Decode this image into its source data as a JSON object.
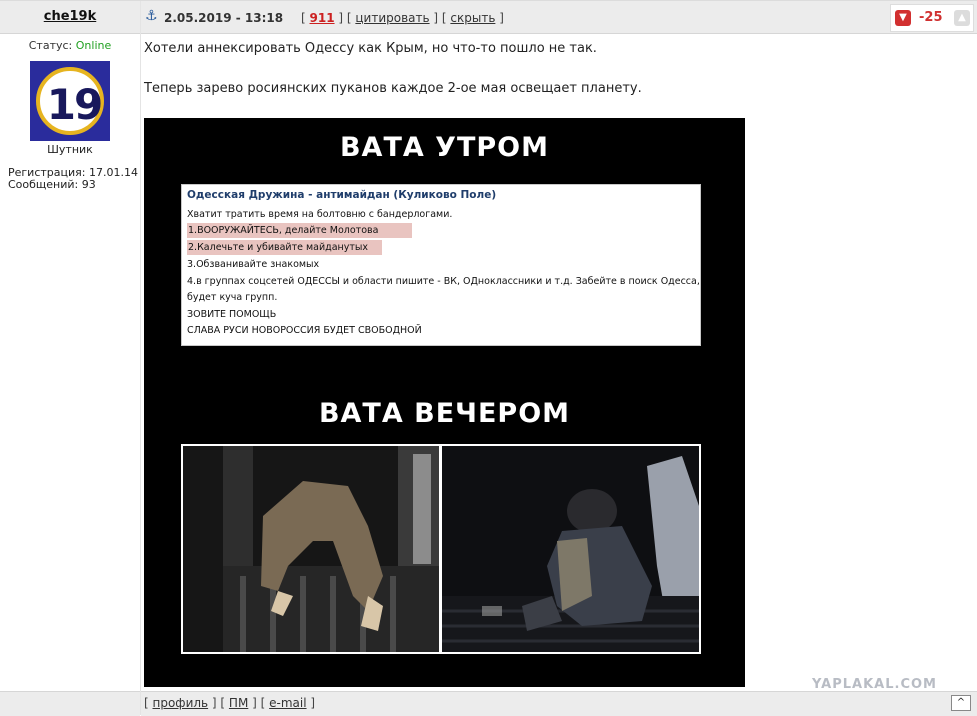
{
  "user": {
    "name": "che19k",
    "status_label": "Статус:",
    "status_value": "Online",
    "avatar_number": "19",
    "rank": "Шутник",
    "registration": "Регистрация: 17.01.14",
    "messages": "Сообщений: 93"
  },
  "header": {
    "date": "2.05.2019 - 13:18",
    "post_count": "911",
    "quote_label": "цитировать",
    "hide_label": "скрыть",
    "rating": "-25"
  },
  "message": {
    "line1": "Хотели аннексировать Одессу как Крым, но что-то пошло не так.",
    "line2": "Теперь зарево росиянских пуканов каждое 2-ое мая освещает планету."
  },
  "meme": {
    "title_top": "ВАТА УТРОМ",
    "panel_title": "Одесская Дружина - антимайдан (Куликово Поле)",
    "panel_lines": [
      "Хватит тратить время на болтовню с бандерлогами.",
      "1.ВООРУЖАЙТЕСЬ, делайте Молотова",
      "2.Калечьте и убивайте майданутых",
      "3.Обзванивайте знакомых",
      "4.в группах соцсетей ОДЕССЫ и области пишите - ВК, ОДноклассники и т.д. Забейте в поиск Одесса,",
      "будет куча групп.",
      "ЗОВИТЕ ПОМОЩЬ",
      "СЛАВА РУСИ НОВОРОССИЯ БУДЕТ СВОБОДНОЙ"
    ],
    "title_bottom": "ВАТА ВЕЧЕРОМ"
  },
  "watermark": "YAPLAKAL.COM",
  "footer": {
    "profile": "профиль",
    "pm": "ПМ",
    "email": "e-mail",
    "up": "^"
  },
  "colors": {
    "online": "#21a021",
    "rating": "#d03030",
    "bar_bg": "#ececec"
  }
}
